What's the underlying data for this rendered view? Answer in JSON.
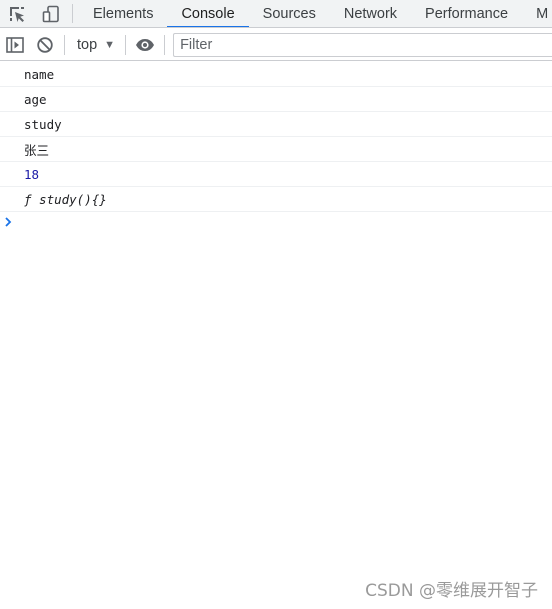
{
  "tabs": [
    {
      "label": "Elements"
    },
    {
      "label": "Console"
    },
    {
      "label": "Sources"
    },
    {
      "label": "Network"
    },
    {
      "label": "Performance"
    },
    {
      "label": "M"
    }
  ],
  "active_tab": "Console",
  "toolbar": {
    "context_label": "top",
    "filter_placeholder": "Filter"
  },
  "console_messages": [
    {
      "text": "name",
      "kind": "string"
    },
    {
      "text": "age",
      "kind": "string"
    },
    {
      "text": "study",
      "kind": "string"
    },
    {
      "text": "张三",
      "kind": "string"
    },
    {
      "text": "18",
      "kind": "number"
    },
    {
      "text": "ƒ study(){}",
      "kind": "function"
    }
  ],
  "watermark": "CSDN @零维展开智子",
  "colors": {
    "accent": "#1a73e8",
    "number": "#1a1aa6",
    "toolbar_bg": "#f1f3f4",
    "border": "#cbcdd1"
  },
  "icons": [
    "inspect-element-icon",
    "device-toolbar-icon",
    "sidebar-toggle-icon",
    "clear-console-icon",
    "eye-icon",
    "prompt-chevron-icon"
  ]
}
